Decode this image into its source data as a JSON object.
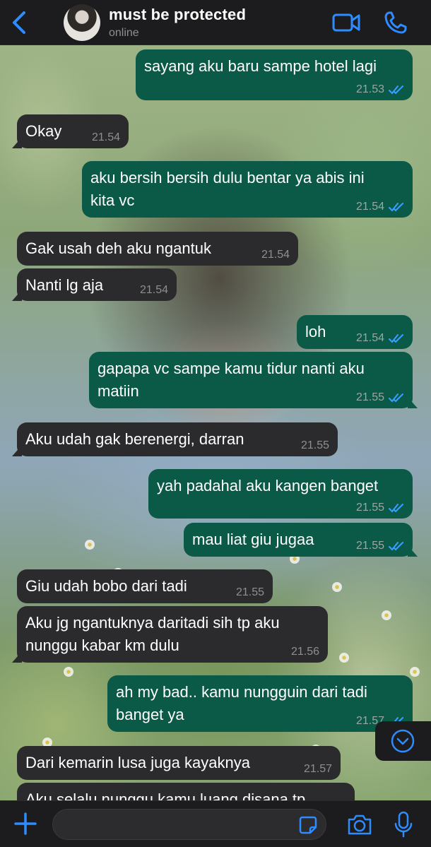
{
  "header": {
    "contact_name": "must be protected",
    "status": "online",
    "accent": "#2f8cff"
  },
  "messages": [
    {
      "dir": "out",
      "lines": [
        "sayang aku baru sampe hotel lagi"
      ],
      "time": "21.53",
      "read": true
    },
    {
      "dir": "in",
      "lines": [
        "Okay"
      ],
      "time": "21.54"
    },
    {
      "dir": "out",
      "lines": [
        "aku bersih bersih dulu bentar ya abis ini",
        "kita vc"
      ],
      "time": "21.54",
      "read": true
    },
    {
      "dir": "in",
      "lines": [
        "Gak usah deh aku ngantuk"
      ],
      "time": "21.54"
    },
    {
      "dir": "in",
      "lines": [
        "Nanti lg aja"
      ],
      "time": "21.54"
    },
    {
      "dir": "out",
      "lines": [
        "loh"
      ],
      "time": "21.54",
      "read": true
    },
    {
      "dir": "out",
      "lines": [
        "gapapa vc sampe kamu tidur nanti aku",
        "matiin"
      ],
      "time": "21.55",
      "read": true
    },
    {
      "dir": "in",
      "lines": [
        "Aku udah gak berenergi, darran"
      ],
      "time": "21.55"
    },
    {
      "dir": "out",
      "lines": [
        "yah padahal aku kangen banget"
      ],
      "time": "21.55",
      "read": true
    },
    {
      "dir": "out",
      "lines": [
        "mau liat giu jugaa"
      ],
      "time": "21.55",
      "read": true
    },
    {
      "dir": "in",
      "lines": [
        "Giu udah bobo dari tadi"
      ],
      "time": "21.55"
    },
    {
      "dir": "in",
      "lines": [
        "Aku jg ngantuknya daritadi sih tp aku",
        "nunggu kabar km dulu"
      ],
      "time": "21.56"
    },
    {
      "dir": "out",
      "lines": [
        "ah my bad.. kamu nungguin dari tadi",
        "banget ya"
      ],
      "time": "21.57",
      "read": true
    },
    {
      "dir": "in",
      "lines": [
        "Dari kemarin lusa juga kayaknya"
      ],
      "time": "21.57"
    },
    {
      "dir": "in",
      "lines": [
        "Aku selalu nunggu kamu luang disana tp"
      ],
      "time": ""
    }
  ],
  "composer": {
    "placeholder": ""
  },
  "icons": {
    "back": "chevron-left-icon",
    "video": "video-camera-icon",
    "call": "phone-icon",
    "scroll": "chevron-down-circle-icon",
    "plus": "plus-icon",
    "sticker": "sticker-icon",
    "camera": "camera-icon",
    "mic": "microphone-icon"
  }
}
